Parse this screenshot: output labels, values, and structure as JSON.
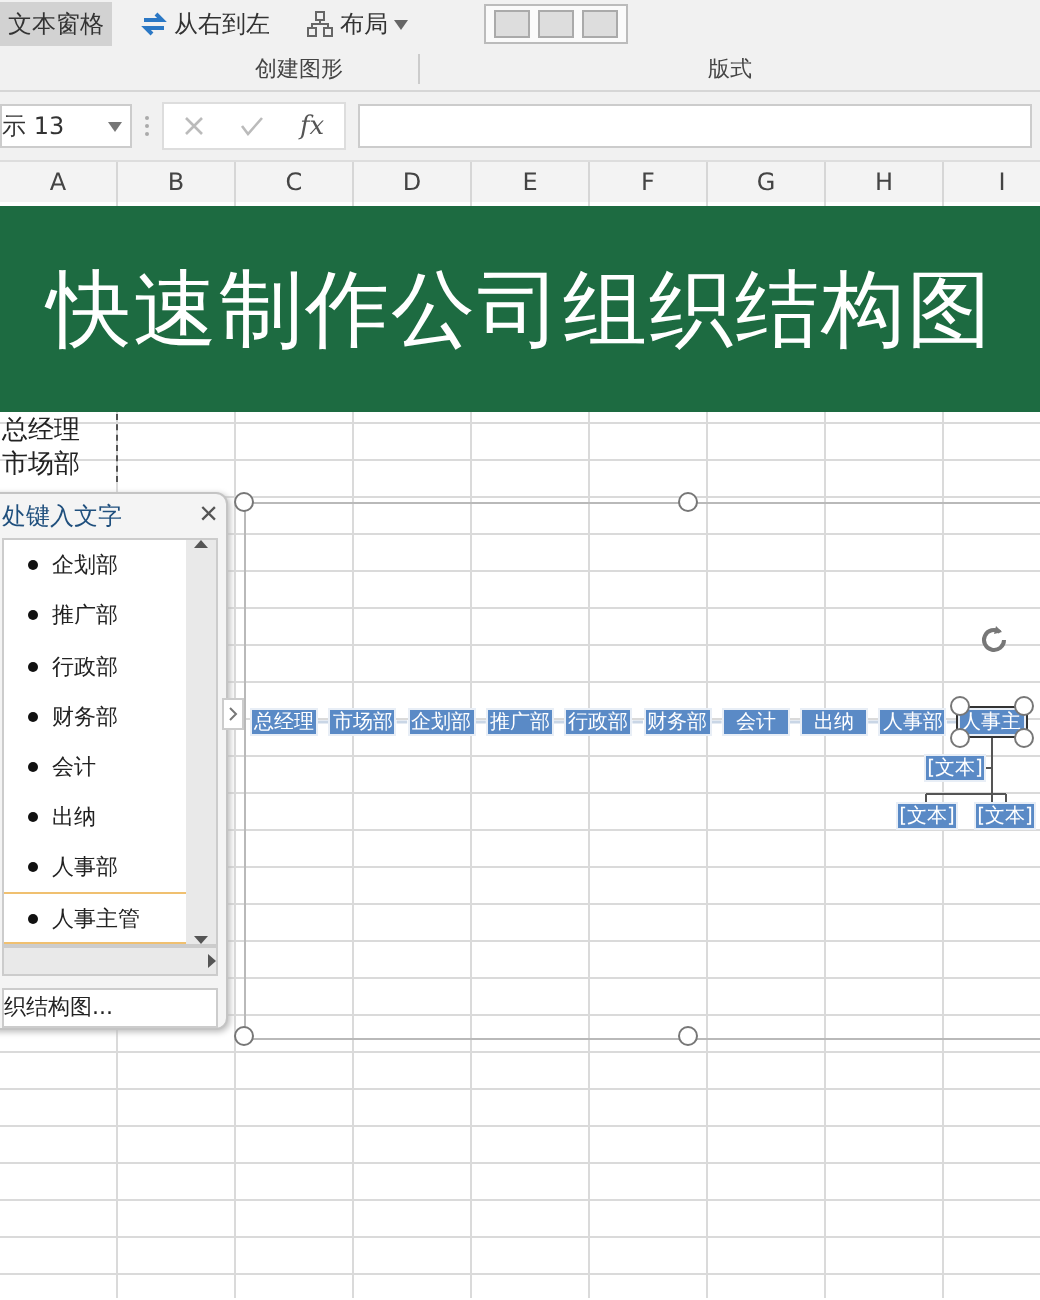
{
  "ribbon": {
    "text_pane_button": {
      "label": "文本窗格",
      "selected": true
    },
    "rtl_button": {
      "label": "从右到左"
    },
    "layout_button": {
      "label": "布局"
    },
    "groups": [
      {
        "label": "创建图形"
      },
      {
        "label": "版式"
      }
    ]
  },
  "formula_bar": {
    "name_box": "示 13",
    "function_label": "fx"
  },
  "columns": [
    "A",
    "B",
    "C",
    "D",
    "E",
    "F",
    "G",
    "H",
    "I"
  ],
  "banner": {
    "title": "快速制作公司组织结构图"
  },
  "cells": [
    "总经理",
    "市场部"
  ],
  "text_pane": {
    "title": "处键入文字",
    "close": "×",
    "link": "织结构图...",
    "items": [
      {
        "label": "企划部",
        "selected": false
      },
      {
        "label": "推广部",
        "selected": false
      },
      {
        "label": "行政部",
        "selected": false
      },
      {
        "label": "财务部",
        "selected": false
      },
      {
        "label": "会计",
        "selected": false
      },
      {
        "label": "出纳",
        "selected": false
      },
      {
        "label": "人事部",
        "selected": false
      },
      {
        "label": "人事主管",
        "selected": true
      }
    ]
  },
  "smartart": {
    "nodes": [
      {
        "label": "总经理",
        "selected": false
      },
      {
        "label": "市场部",
        "selected": false
      },
      {
        "label": "企划部",
        "selected": false
      },
      {
        "label": "推广部",
        "selected": false
      },
      {
        "label": "行政部",
        "selected": false
      },
      {
        "label": "财务部",
        "selected": false
      },
      {
        "label": "会计",
        "selected": false
      },
      {
        "label": "出纳",
        "selected": false
      },
      {
        "label": "人事部",
        "selected": false
      },
      {
        "label": "人事主",
        "selected": true
      }
    ],
    "children": [
      {
        "label": "[文本]"
      },
      {
        "label": "[文本]"
      },
      {
        "label": "[文本]"
      }
    ]
  }
}
